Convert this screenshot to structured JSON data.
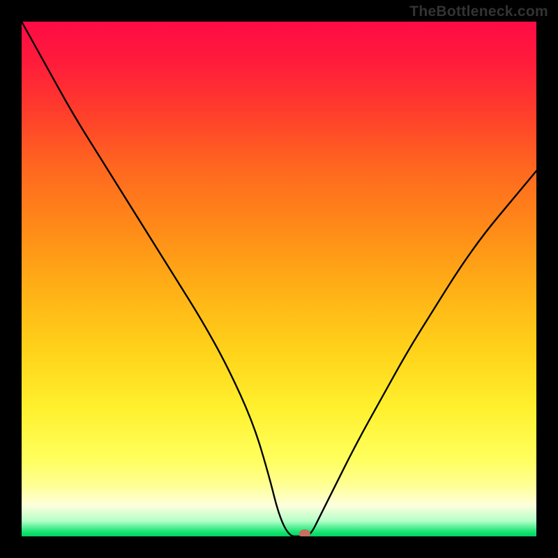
{
  "watermark": "TheBottleneck.com",
  "chart_data": {
    "type": "line",
    "title": "",
    "xlabel": "",
    "ylabel": "",
    "xlim": [
      0,
      100
    ],
    "ylim": [
      0,
      100
    ],
    "series": [
      {
        "name": "curve",
        "x": [
          0,
          5,
          10,
          15,
          20,
          25,
          30,
          35,
          40,
          45,
          48,
          50,
          52,
          54,
          56,
          58,
          60,
          65,
          70,
          75,
          80,
          85,
          90,
          95,
          100
        ],
        "values": [
          100,
          91,
          82,
          74,
          66,
          58,
          50,
          42,
          33,
          22,
          12,
          4,
          0,
          0,
          0,
          4,
          8,
          18,
          27,
          36,
          44,
          52,
          59,
          65,
          71
        ]
      }
    ],
    "marker": {
      "x": 55,
      "y": 0.5
    }
  }
}
